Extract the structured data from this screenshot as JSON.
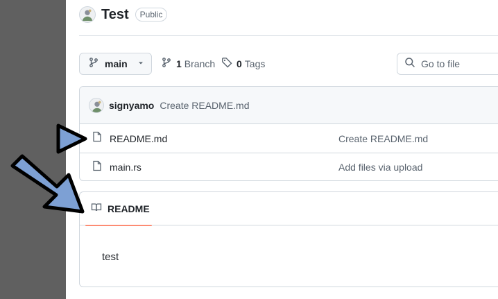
{
  "repo": {
    "name": "Test",
    "visibility": "Public"
  },
  "toolbar": {
    "branch_label": "main",
    "branches_count": "1",
    "branches_label": "Branch",
    "tags_count": "0",
    "tags_label": "Tags",
    "goto_file_placeholder": "Go to file"
  },
  "latest_commit": {
    "author": "signyamo",
    "message": "Create README.md"
  },
  "files": [
    {
      "name": "README.md",
      "commit_message": "Create README.md"
    },
    {
      "name": "main.rs",
      "commit_message": "Add files via upload"
    }
  ],
  "readme": {
    "tab_label": "README",
    "content": "test"
  },
  "icons": [
    "git-branch-icon",
    "chevron-down-icon",
    "tag-icon",
    "search-icon",
    "file-icon",
    "book-icon"
  ],
  "colors": {
    "accent_underline": "#fd8c73",
    "arrow_fill": "#7da0d4",
    "arrow_stroke": "#000000",
    "gutter": "#606060"
  }
}
